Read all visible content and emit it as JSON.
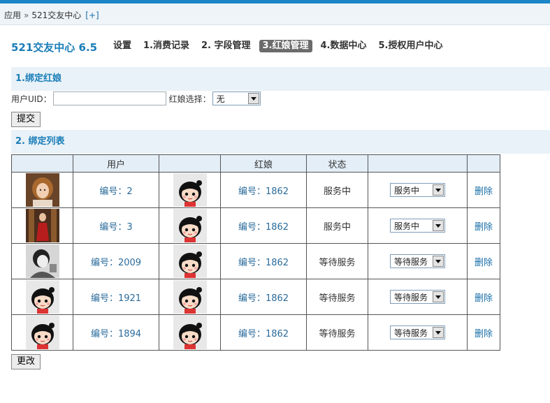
{
  "breadcrumb": {
    "root": "应用",
    "separator": "»",
    "current": "521交友中心",
    "add_label": "[+]"
  },
  "app_title": "521交友中心 6.5",
  "nav": {
    "settings": "设置",
    "consumption": "1.消费记录",
    "fields": "2. 字段管理",
    "matchmaker": "3.红娘管理",
    "data": "4.数据中心",
    "auth": "5.授权用户中心",
    "active": "3.红娘管理"
  },
  "bind_section": {
    "title": "1.绑定红娘",
    "uid_label": "用户UID：",
    "uid_value": "",
    "matchmaker_label": "红娘选择：",
    "matchmaker_selected": "无",
    "submit_label": "提交"
  },
  "list_section": {
    "title": "2. 绑定列表",
    "headers": [
      "",
      "用户",
      "",
      "红娘",
      "状态",
      "",
      ""
    ],
    "rows": [
      {
        "user_avatar": "photo-girl-1",
        "user": "编号：2",
        "matchmaker_avatar": "cartoon-girl",
        "matchmaker": "编号：1862",
        "status": "服务中",
        "status_select": "服务中",
        "delete": "删除"
      },
      {
        "user_avatar": "photo-girl-2",
        "user": "编号：3",
        "matchmaker_avatar": "cartoon-girl",
        "matchmaker": "编号：1862",
        "status": "服务中",
        "status_select": "服务中",
        "delete": "删除"
      },
      {
        "user_avatar": "photo-bw",
        "user": "编号：2009",
        "matchmaker_avatar": "cartoon-girl",
        "matchmaker": "编号：1862",
        "status": "等待服务",
        "status_select": "等待服务",
        "delete": "删除"
      },
      {
        "user_avatar": "cartoon-girl",
        "user": "编号：1921",
        "matchmaker_avatar": "cartoon-girl",
        "matchmaker": "编号：1862",
        "status": "等待服务",
        "status_select": "等待服务",
        "delete": "删除"
      },
      {
        "user_avatar": "cartoon-girl",
        "user": "编号：1894",
        "matchmaker_avatar": "cartoon-girl",
        "matchmaker": "编号：1862",
        "status": "等待服务",
        "status_select": "等待服务",
        "delete": "删除"
      }
    ],
    "update_label": "更改"
  },
  "colors": {
    "accent": "#1a7db8",
    "topbar": "#1a86c8",
    "section_bg": "#e9f2f8",
    "header_bg": "#e3eef7"
  }
}
